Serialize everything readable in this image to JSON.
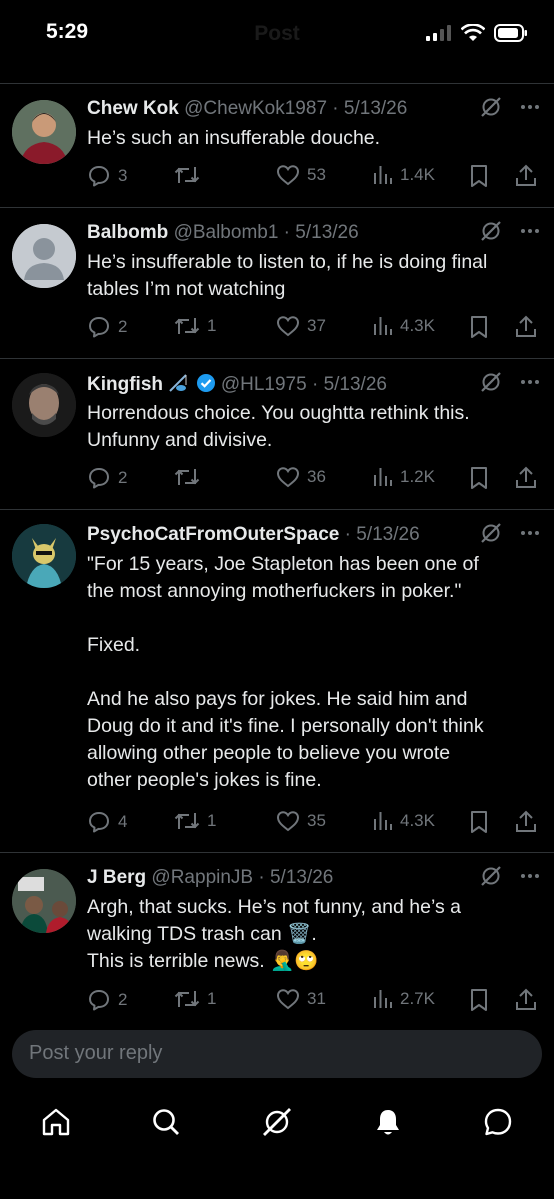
{
  "status_bar": {
    "time": "5:29",
    "title": "Post"
  },
  "tweets": [
    {
      "name": "Chew Kok",
      "handle": "@ChewKok1987",
      "date": "5/13/26",
      "lines": [
        "He’s such an insufferable douche."
      ],
      "replies": "3",
      "reposts": "",
      "likes": "53",
      "views": "1.4K"
    },
    {
      "name": "Balbomb",
      "handle": "@Balbomb1",
      "date": "5/13/26",
      "lines": [
        "He’s insufferable to listen to, if he is doing final",
        "tables I’m not watching"
      ],
      "replies": "2",
      "reposts": "1",
      "likes": "37",
      "views": "4.3K"
    },
    {
      "name": "Kingfish",
      "handle": "@HL1975",
      "date": "5/13/26",
      "lines": [
        "Horrendous choice. You oughtta rethink this.",
        "Unfunny and divisive."
      ],
      "replies": "2",
      "reposts": "",
      "likes": "36",
      "views": "1.2K"
    },
    {
      "name": "PsychoCatFromOuterSpace",
      "handle": "",
      "date": "5/13/26",
      "lines": [
        "\"For 15 years, Joe Stapleton has been one of",
        "the most annoying motherfuckers in poker.\"",
        "",
        "Fixed.",
        "",
        "And he also pays for jokes. He said him and",
        "Doug do it and it's fine. I personally don't think",
        "allowing other people to believe you wrote",
        "other people's jokes is fine."
      ],
      "replies": "4",
      "reposts": "1",
      "likes": "35",
      "views": "4.3K"
    },
    {
      "name": "J Berg",
      "handle": "@RappinJB",
      "date": "5/13/26",
      "lines": [
        "Argh, that sucks. He’s not funny, and he’s a",
        "walking TDS trash can 🗑️.",
        "This is terrible news. 🤦‍♂️🙄"
      ],
      "replies": "2",
      "reposts": "1",
      "likes": "31",
      "views": "2.7K"
    }
  ],
  "reply_box": {
    "placeholder": "Post your reply"
  },
  "nav": [
    "home-icon",
    "search-icon",
    "grok-icon",
    "notifications-icon",
    "messages-icon"
  ],
  "colors": {
    "background": "#000000",
    "text": "#e7e9ea",
    "muted": "#71767b",
    "verified": "#1d9bf0",
    "divider": "#2f3336"
  }
}
